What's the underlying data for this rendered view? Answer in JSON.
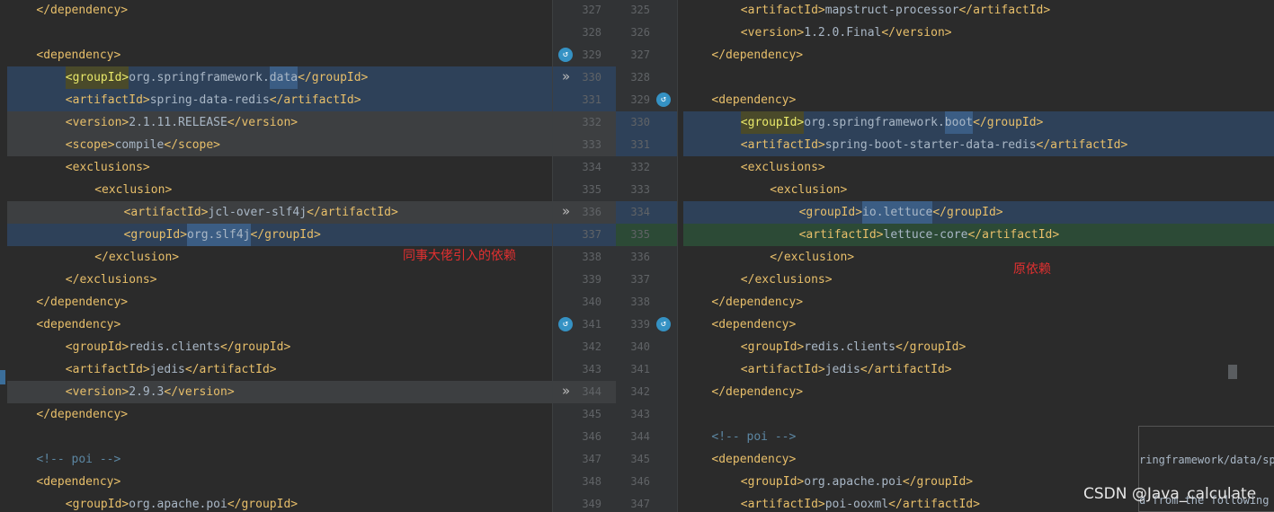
{
  "left": {
    "lines": [
      {
        "indent": 2,
        "parts": [
          [
            "tag",
            "</dependency>"
          ]
        ],
        "bg": ""
      },
      {
        "indent": 0,
        "parts": [],
        "bg": ""
      },
      {
        "indent": 2,
        "parts": [
          [
            "tag",
            "<dependency>"
          ]
        ],
        "bg": ""
      },
      {
        "indent": 4,
        "parts": [
          [
            "tagy",
            "<groupId>"
          ],
          [
            "txt",
            "org.springframework."
          ],
          [
            "hi",
            "data"
          ],
          [
            "tag",
            "</groupId>"
          ]
        ],
        "bg": "blue"
      },
      {
        "indent": 4,
        "parts": [
          [
            "tag",
            "<artifactId>"
          ],
          [
            "txt",
            "spring-data-redis"
          ],
          [
            "tag",
            "</artifactId>"
          ]
        ],
        "bg": "blue"
      },
      {
        "indent": 4,
        "parts": [
          [
            "tag",
            "<version>"
          ],
          [
            "txt",
            "2.1.11.RELEASE"
          ],
          [
            "tag",
            "</version>"
          ]
        ],
        "bg": "gray"
      },
      {
        "indent": 4,
        "parts": [
          [
            "tag",
            "<scope>"
          ],
          [
            "txt",
            "compile"
          ],
          [
            "tag",
            "</scope>"
          ]
        ],
        "bg": "gray"
      },
      {
        "indent": 4,
        "parts": [
          [
            "tag",
            "<exclusions>"
          ]
        ],
        "bg": ""
      },
      {
        "indent": 6,
        "parts": [
          [
            "tag",
            "<exclusion>"
          ]
        ],
        "bg": ""
      },
      {
        "indent": 8,
        "parts": [
          [
            "tag",
            "<artifactId>"
          ],
          [
            "txt",
            "jcl-over-slf4j"
          ],
          [
            "tag",
            "</artifactId>"
          ]
        ],
        "bg": "gray"
      },
      {
        "indent": 8,
        "parts": [
          [
            "tag",
            "<groupId>"
          ],
          [
            "hi",
            "org.slf4j"
          ],
          [
            "tag",
            "</groupId>"
          ]
        ],
        "bg": "blue"
      },
      {
        "indent": 6,
        "parts": [
          [
            "tag",
            "</exclusion>"
          ]
        ],
        "bg": ""
      },
      {
        "indent": 4,
        "parts": [
          [
            "tag",
            "</exclusions>"
          ]
        ],
        "bg": ""
      },
      {
        "indent": 2,
        "parts": [
          [
            "tag",
            "</dependency>"
          ]
        ],
        "bg": ""
      },
      {
        "indent": 2,
        "parts": [
          [
            "tag",
            "<dependency>"
          ]
        ],
        "bg": ""
      },
      {
        "indent": 4,
        "parts": [
          [
            "tag",
            "<groupId>"
          ],
          [
            "txt",
            "redis.clients"
          ],
          [
            "tag",
            "</groupId>"
          ]
        ],
        "bg": ""
      },
      {
        "indent": 4,
        "parts": [
          [
            "tag",
            "<artifactId>"
          ],
          [
            "txt",
            "jedis"
          ],
          [
            "tag",
            "</artifactId>"
          ]
        ],
        "bg": ""
      },
      {
        "indent": 4,
        "parts": [
          [
            "tag",
            "<version>"
          ],
          [
            "txt",
            "2.9.3"
          ],
          [
            "tag",
            "</version>"
          ]
        ],
        "bg": "gray"
      },
      {
        "indent": 2,
        "parts": [
          [
            "tag",
            "</dependency>"
          ]
        ],
        "bg": ""
      },
      {
        "indent": 0,
        "parts": [],
        "bg": ""
      },
      {
        "indent": 2,
        "parts": [
          [
            "cmt",
            "<!-- poi -->"
          ]
        ],
        "bg": ""
      },
      {
        "indent": 2,
        "parts": [
          [
            "tag",
            "<dependency>"
          ]
        ],
        "bg": ""
      },
      {
        "indent": 4,
        "parts": [
          [
            "tag",
            "<groupId>"
          ],
          [
            "txt",
            "org.apache.poi"
          ],
          [
            "tag",
            "</groupId>"
          ]
        ],
        "bg": ""
      }
    ],
    "note": "同事大佬引入的依赖"
  },
  "gutter": {
    "left_numbers": [
      "327",
      "328",
      "329",
      "330",
      "331",
      "332",
      "333",
      "334",
      "335",
      "336",
      "337",
      "338",
      "339",
      "340",
      "341",
      "342",
      "343",
      "344",
      "345",
      "346",
      "347",
      "348",
      "349"
    ],
    "right_numbers": [
      "325",
      "326",
      "327",
      "328",
      "329",
      "330",
      "331",
      "332",
      "333",
      "334",
      "335",
      "336",
      "337",
      "338",
      "339",
      "340",
      "341",
      "342",
      "343",
      "344",
      "345",
      "346",
      "347"
    ],
    "arrow_glyph": "»",
    "icon_glyph": "↺"
  },
  "right": {
    "lines": [
      {
        "indent": 4,
        "parts": [
          [
            "tag",
            "<artifactId>"
          ],
          [
            "txt",
            "mapstruct-processor"
          ],
          [
            "tag",
            "</artifactId>"
          ]
        ],
        "bg": ""
      },
      {
        "indent": 4,
        "parts": [
          [
            "tag",
            "<version>"
          ],
          [
            "txt",
            "1.2.0.Final"
          ],
          [
            "tag",
            "</version>"
          ]
        ],
        "bg": ""
      },
      {
        "indent": 2,
        "parts": [
          [
            "tag",
            "</dependency>"
          ]
        ],
        "bg": ""
      },
      {
        "indent": 0,
        "parts": [],
        "bg": ""
      },
      {
        "indent": 2,
        "parts": [
          [
            "tag",
            "<dependency>"
          ]
        ],
        "bg": ""
      },
      {
        "indent": 4,
        "parts": [
          [
            "tagy",
            "<groupId>"
          ],
          [
            "txt",
            "org.springframework."
          ],
          [
            "hi",
            "boot"
          ],
          [
            "tag",
            "</groupId>"
          ]
        ],
        "bg": "blue"
      },
      {
        "indent": 4,
        "parts": [
          [
            "tag",
            "<artifactId>"
          ],
          [
            "txt",
            "spring-boot-starter-data-redis"
          ],
          [
            "tag",
            "</artifactId>"
          ]
        ],
        "bg": "blue"
      },
      {
        "indent": 4,
        "parts": [
          [
            "tag",
            "<exclusions>"
          ]
        ],
        "bg": ""
      },
      {
        "indent": 6,
        "parts": [
          [
            "tag",
            "<exclusion>"
          ]
        ],
        "bg": ""
      },
      {
        "indent": 8,
        "parts": [
          [
            "tag",
            "<groupId>"
          ],
          [
            "hi",
            "io.lettuce"
          ],
          [
            "tag",
            "</groupId>"
          ]
        ],
        "bg": "blue"
      },
      {
        "indent": 8,
        "parts": [
          [
            "tag",
            "<artifactId>"
          ],
          [
            "txt",
            "lettuce-core"
          ],
          [
            "tag",
            "</artifactId>"
          ]
        ],
        "bg": "green"
      },
      {
        "indent": 6,
        "parts": [
          [
            "tag",
            "</exclusion>"
          ]
        ],
        "bg": ""
      },
      {
        "indent": 4,
        "parts": [
          [
            "tag",
            "</exclusions>"
          ]
        ],
        "bg": ""
      },
      {
        "indent": 2,
        "parts": [
          [
            "tag",
            "</dependency>"
          ]
        ],
        "bg": ""
      },
      {
        "indent": 2,
        "parts": [
          [
            "tag",
            "<dependency>"
          ]
        ],
        "bg": ""
      },
      {
        "indent": 4,
        "parts": [
          [
            "tag",
            "<groupId>"
          ],
          [
            "txt",
            "redis.clients"
          ],
          [
            "tag",
            "</groupId>"
          ]
        ],
        "bg": ""
      },
      {
        "indent": 4,
        "parts": [
          [
            "tag",
            "<artifactId>"
          ],
          [
            "txt",
            "jedis"
          ],
          [
            "tag",
            "</artifactId>"
          ]
        ],
        "bg": ""
      },
      {
        "indent": 2,
        "parts": [
          [
            "tag",
            "</dependency>"
          ]
        ],
        "bg": ""
      },
      {
        "indent": 0,
        "parts": [],
        "bg": ""
      },
      {
        "indent": 2,
        "parts": [
          [
            "cmt",
            "<!-- poi -->"
          ]
        ],
        "bg": ""
      },
      {
        "indent": 2,
        "parts": [
          [
            "tag",
            "<dependency>"
          ]
        ],
        "bg": ""
      },
      {
        "indent": 4,
        "parts": [
          [
            "tag",
            "<groupId>"
          ],
          [
            "txt",
            "org.apache.poi"
          ],
          [
            "tag",
            "</groupId>"
          ]
        ],
        "bg": ""
      },
      {
        "indent": 4,
        "parts": [
          [
            "tag",
            "<artifactId>"
          ],
          [
            "txt",
            "poi-ooxml"
          ],
          [
            "tag",
            "</artifactId>"
          ]
        ],
        "bg": ""
      }
    ],
    "note": "原依赖"
  },
  "popup": {
    "line1": "ringframework/data/spr",
    "line2": "d from the following j"
  },
  "watermark": "CSDN @Java_calculate",
  "colors": {
    "tag": "#e8bf6a",
    "text": "#a9b7c6",
    "comment": "#5c87a3",
    "note": "#e03030"
  }
}
